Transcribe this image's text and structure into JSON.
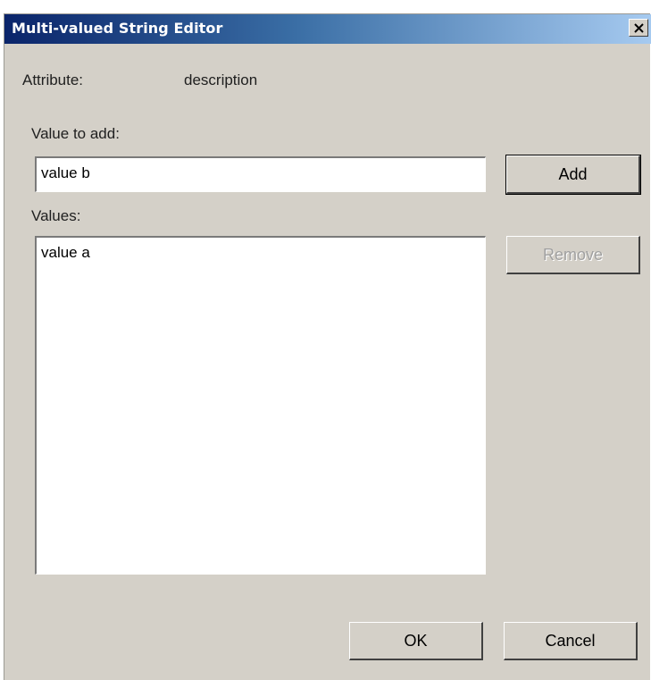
{
  "window": {
    "title": "Multi-valued String Editor",
    "close_icon": "close-icon"
  },
  "attribute": {
    "label": "Attribute:",
    "value": "description"
  },
  "value_to_add": {
    "label": "Value to add:",
    "value": "value b"
  },
  "values": {
    "label": "Values:",
    "items": [
      "value a"
    ]
  },
  "buttons": {
    "add": "Add",
    "remove": "Remove",
    "ok": "OK",
    "cancel": "Cancel"
  }
}
